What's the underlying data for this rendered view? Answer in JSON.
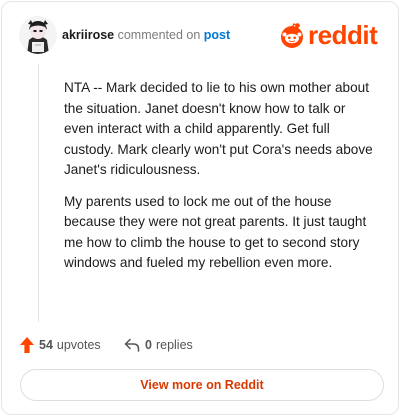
{
  "header": {
    "username": "akriirose",
    "action": "commented on",
    "object": "post",
    "logo_text": "reddit",
    "brand_color": "#ff4500"
  },
  "comment": {
    "paragraphs": [
      "NTA -- Mark decided to lie to his own mother about the situation. Janet doesn't know how to talk or even interact with a child apparently. Get full custody. Mark clearly won't put Cora's needs above Janet's ridiculousness.",
      "My parents used to lock me out of the house because they were not great parents. It just taught me how to climb the house to get to second story windows and fueled my rebellion even more."
    ]
  },
  "footer": {
    "upvotes_count": "54",
    "upvotes_label": "upvotes",
    "replies_count": "0",
    "replies_label": "replies",
    "upvote_icon": "upvote-arrow-icon",
    "reply_icon": "reply-arrow-icon"
  },
  "cta": {
    "label": "View more on Reddit"
  }
}
